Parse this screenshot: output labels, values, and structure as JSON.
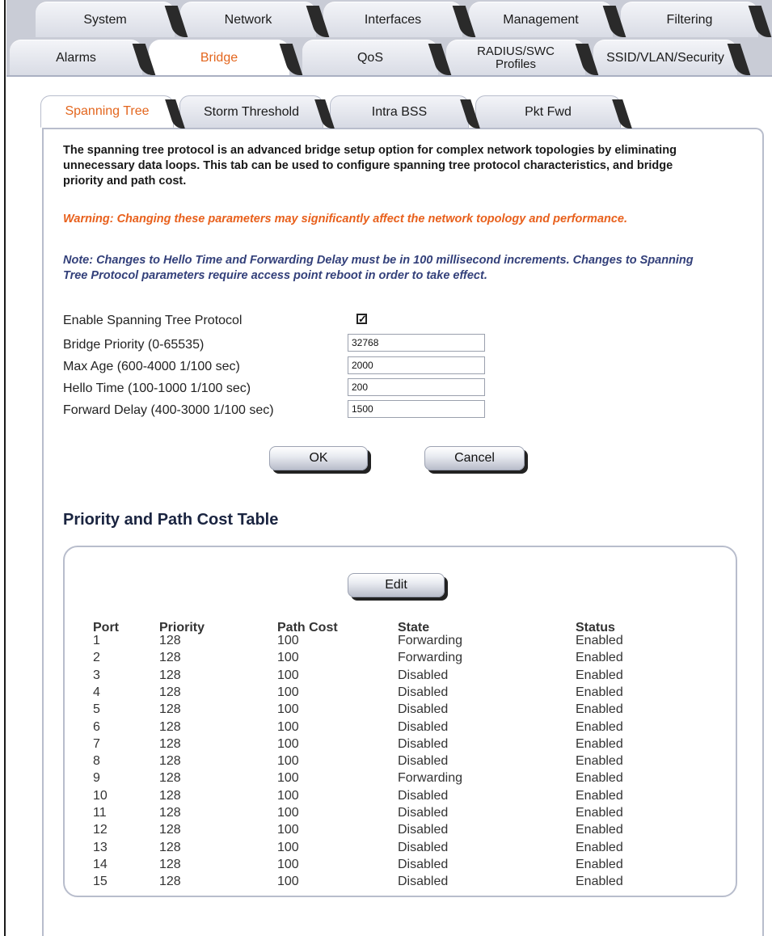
{
  "top_tabs": [
    "System",
    "Network",
    "Interfaces",
    "Management",
    "Filtering"
  ],
  "second_tabs": [
    "Alarms",
    "Bridge",
    "QoS",
    "RADIUS/SWC Profiles",
    "SSID/VLAN/Security"
  ],
  "active_second_tab": "Bridge",
  "sub_tabs": [
    "Spanning Tree",
    "Storm Threshold",
    "Intra BSS",
    "Pkt Fwd"
  ],
  "active_sub_tab": "Spanning Tree",
  "description": "The spanning tree protocol is an advanced bridge setup option for complex network topologies by eliminating unnecessary data loops. This tab can be used to configure spanning tree protocol characteristics, and bridge priority and path cost.",
  "warning": "Warning: Changing these parameters may significantly affect the network topology and performance.",
  "note": "Note: Changes to Hello Time and Forwarding Delay must be in 100 millisecond increments. Changes to Spanning Tree Protocol parameters require access point reboot in order to take effect.",
  "form": {
    "enable_label": "Enable Spanning Tree Protocol",
    "enable_checked": true,
    "bridge_priority_label": "Bridge Priority (0-65535)",
    "bridge_priority_value": "32768",
    "max_age_label": "Max Age (600-4000 1/100 sec)",
    "max_age_value": "2000",
    "hello_time_label": "Hello Time (100-1000 1/100 sec)",
    "hello_time_value": "200",
    "forward_delay_label": "Forward Delay (400-3000 1/100 sec)",
    "forward_delay_value": "1500"
  },
  "buttons": {
    "ok": "OK",
    "cancel": "Cancel",
    "edit": "Edit"
  },
  "table_title": "Priority and Path Cost Table",
  "table": {
    "headers": [
      "Port",
      "Priority",
      "Path Cost",
      "State",
      "Status"
    ],
    "rows": [
      [
        "1",
        "128",
        "100",
        "Forwarding",
        "Enabled"
      ],
      [
        "2",
        "128",
        "100",
        "Forwarding",
        "Enabled"
      ],
      [
        "3",
        "128",
        "100",
        "Disabled",
        "Enabled"
      ],
      [
        "4",
        "128",
        "100",
        "Disabled",
        "Enabled"
      ],
      [
        "5",
        "128",
        "100",
        "Disabled",
        "Enabled"
      ],
      [
        "6",
        "128",
        "100",
        "Disabled",
        "Enabled"
      ],
      [
        "7",
        "128",
        "100",
        "Disabled",
        "Enabled"
      ],
      [
        "8",
        "128",
        "100",
        "Disabled",
        "Enabled"
      ],
      [
        "9",
        "128",
        "100",
        "Forwarding",
        "Enabled"
      ],
      [
        "10",
        "128",
        "100",
        "Disabled",
        "Enabled"
      ],
      [
        "11",
        "128",
        "100",
        "Disabled",
        "Enabled"
      ],
      [
        "12",
        "128",
        "100",
        "Disabled",
        "Enabled"
      ],
      [
        "13",
        "128",
        "100",
        "Disabled",
        "Enabled"
      ],
      [
        "14",
        "128",
        "100",
        "Disabled",
        "Enabled"
      ],
      [
        "15",
        "128",
        "100",
        "Disabled",
        "Enabled"
      ]
    ]
  },
  "colors": {
    "accent": "#e3661e",
    "warning": "#e8601c",
    "note": "#33407a",
    "tab_bg": "#c9ccd6"
  }
}
